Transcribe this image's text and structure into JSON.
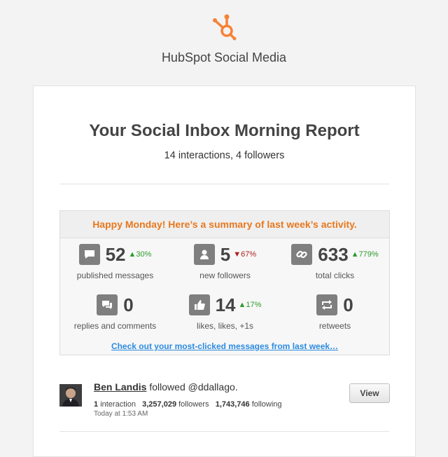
{
  "header": {
    "brand": "HubSpot Social Media",
    "logo_icon": "hubspot-sprocket-icon",
    "accent": "#f58235"
  },
  "report": {
    "title": "Your Social Inbox Morning Report",
    "subtitle": "14 interactions, 4 followers"
  },
  "summary": {
    "heading": "Happy Monday! Here’s a summary of last week’s activity.",
    "heading_color": "#e8781e",
    "stats": [
      {
        "icon": "chat-bubble-icon",
        "value": "52",
        "delta": "30%",
        "direction": "up",
        "label": "published messages"
      },
      {
        "icon": "person-icon",
        "value": "5",
        "delta": "67%",
        "direction": "down",
        "label": "new followers"
      },
      {
        "icon": "link-icon",
        "value": "633",
        "delta": "779%",
        "direction": "up",
        "label": "total clicks"
      },
      {
        "icon": "chat-bubbles-icon",
        "value": "0",
        "delta": "",
        "direction": "",
        "label": "replies and comments"
      },
      {
        "icon": "thumbs-up-icon",
        "value": "14",
        "delta": "17%",
        "direction": "up",
        "label": "likes, likes, +1s"
      },
      {
        "icon": "retweet-icon",
        "value": "0",
        "delta": "",
        "direction": "",
        "label": "retweets"
      }
    ],
    "link_text": "Check out your most-clicked messages from last week…"
  },
  "activity": {
    "name": "Ben Landis",
    "action": "followed @ddallago.",
    "interactions_count": "1",
    "interactions_label": "interaction",
    "followers_count": "3,257,029",
    "followers_label": "followers",
    "following_count": "1,743,746",
    "following_label": "following",
    "time": "Today at 1:53 AM",
    "button": "View"
  }
}
